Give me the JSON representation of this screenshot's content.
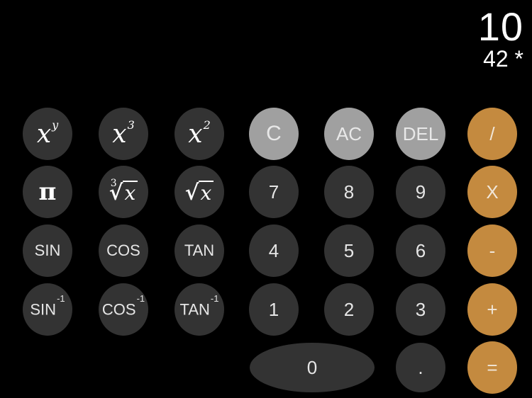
{
  "display": {
    "result": "10",
    "expression": "42 *"
  },
  "colors": {
    "background": "#000000",
    "digit_button": "#333333",
    "function_button": "#a0a0a0",
    "operator_button": "#c48a3f",
    "text": "#e6e6e6"
  },
  "scientific": {
    "power_y": {
      "base": "x",
      "exp": "y"
    },
    "cube": {
      "base": "x",
      "exp": "3"
    },
    "square": {
      "base": "x",
      "exp": "2"
    },
    "pi": "π",
    "cube_root": {
      "index": "3",
      "radical": "√",
      "radicand": "x"
    },
    "square_root": {
      "radical": "√",
      "radicand": "x"
    },
    "sin": "SIN",
    "cos": "COS",
    "tan": "TAN",
    "asin": {
      "label": "SIN",
      "sup": "-1"
    },
    "acos": {
      "label": "COS",
      "sup": "-1"
    },
    "atan": {
      "label": "TAN",
      "sup": "-1"
    }
  },
  "functions": {
    "clear": "C",
    "all_clear": "AC",
    "delete": "DEL"
  },
  "operators": {
    "divide": "/",
    "multiply": "X",
    "subtract": "-",
    "add": "+",
    "equals": "="
  },
  "digits": {
    "d0": "0",
    "d1": "1",
    "d2": "2",
    "d3": "3",
    "d4": "4",
    "d5": "5",
    "d6": "6",
    "d7": "7",
    "d8": "8",
    "d9": "9",
    "decimal": "."
  }
}
